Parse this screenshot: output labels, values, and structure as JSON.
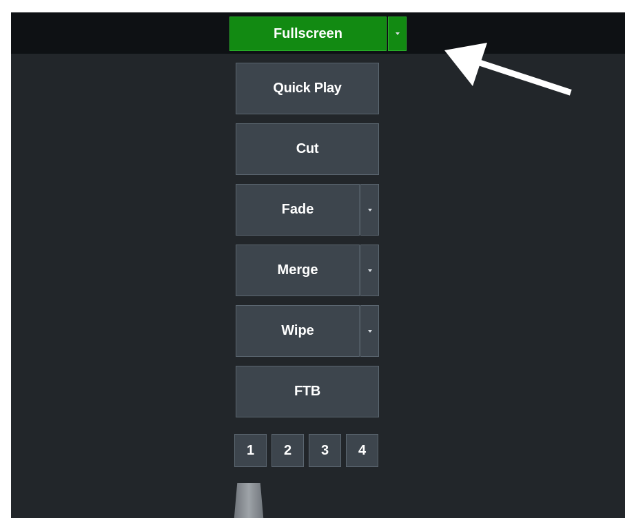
{
  "topbar": {
    "fullscreen_label": "Fullscreen"
  },
  "transitions": {
    "quick_play": "Quick Play",
    "cut": "Cut",
    "fade": "Fade",
    "merge": "Merge",
    "wipe": "Wipe",
    "ftb": "FTB"
  },
  "transition_numbers": [
    "1",
    "2",
    "3",
    "4"
  ],
  "colors": {
    "panel_bg": "#22262a",
    "topbar_bg": "#0e1114",
    "button_bg": "#3d454d",
    "button_border": "#5b6670",
    "fullscreen_active": "#128a12",
    "annotation_arrow": "#ffffff"
  }
}
